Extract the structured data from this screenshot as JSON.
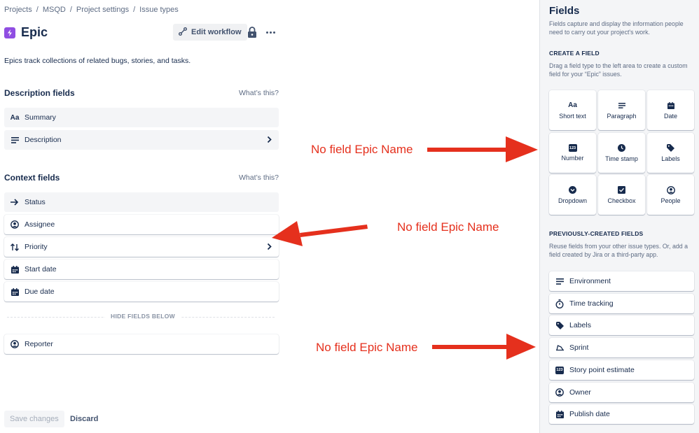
{
  "breadcrumb": [
    "Projects",
    "MSQD",
    "Project settings",
    "Issue types"
  ],
  "breadcrumb_sep": "/",
  "page": {
    "title": "Epic",
    "edit_workflow": "Edit workflow",
    "description": "Epics track collections of related bugs, stories, and tasks."
  },
  "description_fields": {
    "title": "Description fields",
    "whats_this": "What’s this?",
    "items": [
      {
        "label": "Summary",
        "icon": "short-text-icon"
      },
      {
        "label": "Description",
        "icon": "paragraph-icon"
      }
    ]
  },
  "context_fields": {
    "title": "Context fields",
    "whats_this": "What’s this?",
    "items": [
      {
        "label": "Status",
        "icon": "arrow-right-icon"
      },
      {
        "label": "Assignee",
        "icon": "person-icon"
      },
      {
        "label": "Priority",
        "icon": "priority-icon"
      },
      {
        "label": "Start date",
        "icon": "calendar-icon"
      },
      {
        "label": "Due date",
        "icon": "calendar-icon"
      }
    ],
    "hide_label": "HIDE FIELDS BELOW",
    "hidden_items": [
      {
        "label": "Reporter",
        "icon": "person-icon"
      }
    ]
  },
  "footer": {
    "save": "Save changes",
    "discard": "Discard"
  },
  "annotations": {
    "text1": "No field Epic Name",
    "text2": "No field Epic Name",
    "text3": "No field Epic Name",
    "color": "#e5301d"
  },
  "panel": {
    "title": "Fields",
    "description": "Fields capture and display the information people need to carry out your project's work.",
    "create_title": "CREATE A FIELD",
    "create_desc": "Drag a field type to the left area to create a custom field for your “Epic” issues.",
    "tiles": [
      {
        "label": "Short text",
        "icon": "short-text-icon"
      },
      {
        "label": "Paragraph",
        "icon": "paragraph-icon"
      },
      {
        "label": "Date",
        "icon": "calendar-icon"
      },
      {
        "label": "Number",
        "icon": "number-icon"
      },
      {
        "label": "Time stamp",
        "icon": "clock-icon"
      },
      {
        "label": "Labels",
        "icon": "tag-icon"
      },
      {
        "label": "Dropdown",
        "icon": "dropdown-icon"
      },
      {
        "label": "Checkbox",
        "icon": "checkbox-icon"
      },
      {
        "label": "People",
        "icon": "person-icon"
      }
    ],
    "short_text_glyph": "Aa",
    "number_glyph": "123",
    "prev_title": "PREVIOUSLY-CREATED FIELDS",
    "prev_desc": "Reuse fields from your other issue types. Or, add a field created by Jira or a third-party app.",
    "prev_items": [
      {
        "label": "Environment",
        "icon": "paragraph-icon"
      },
      {
        "label": "Time tracking",
        "icon": "stopwatch-icon"
      },
      {
        "label": "Labels",
        "icon": "tag-icon"
      },
      {
        "label": "Sprint",
        "icon": "sprint-icon"
      },
      {
        "label": "Story point estimate",
        "icon": "number-icon"
      },
      {
        "label": "Owner",
        "icon": "person-icon"
      },
      {
        "label": "Publish date",
        "icon": "calendar-icon"
      }
    ]
  }
}
